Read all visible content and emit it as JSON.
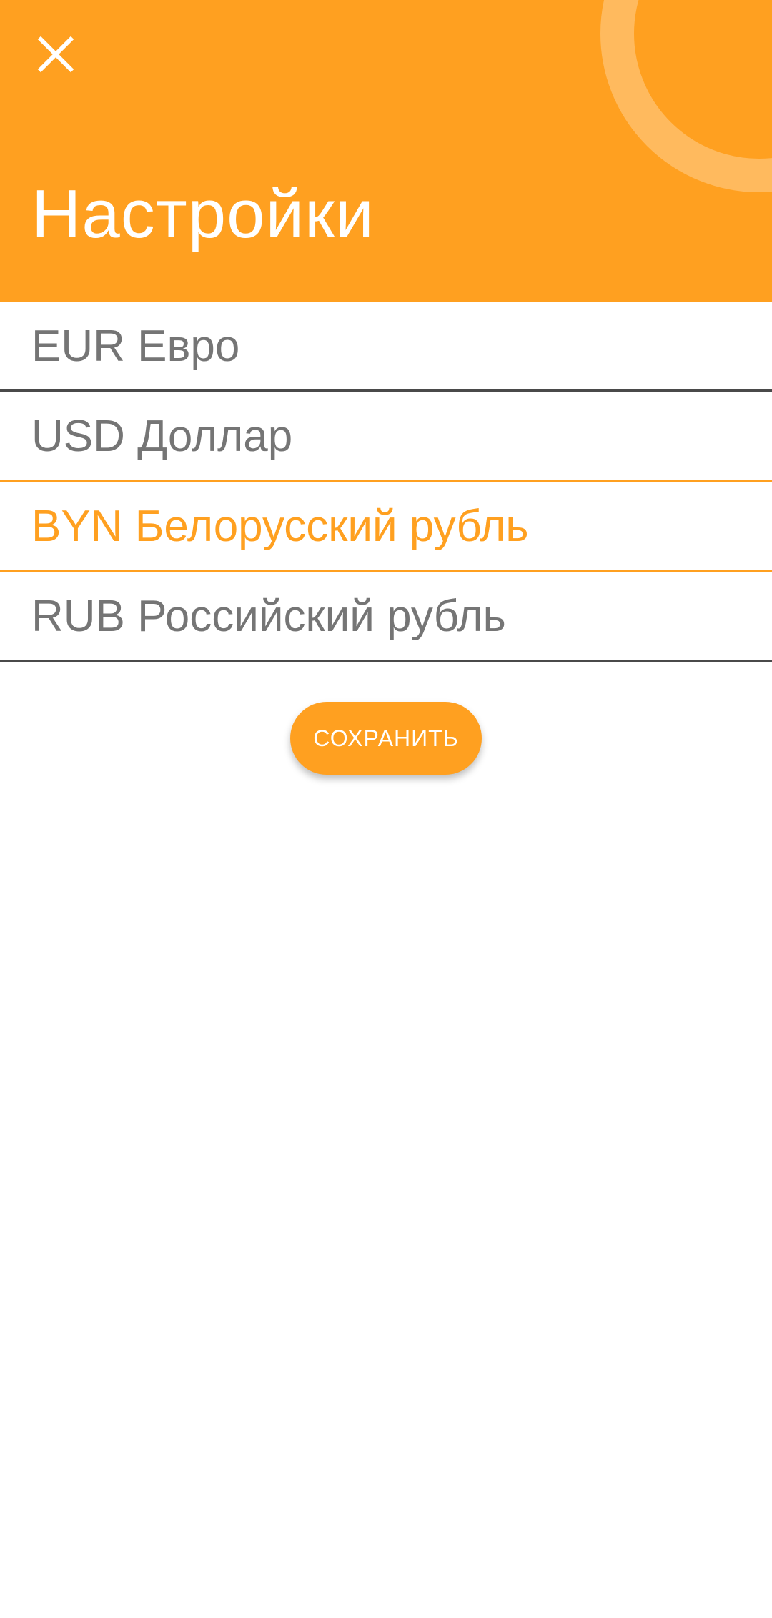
{
  "header": {
    "title": "Настройки",
    "close_icon": "close-icon",
    "color": "#FFA020"
  },
  "currencies": [
    {
      "label": "EUR Евро",
      "selected": false
    },
    {
      "label": "USD Доллар",
      "selected": false
    },
    {
      "label": "BYN Белорусский рубль",
      "selected": true
    },
    {
      "label": "RUB Российский рубль",
      "selected": false
    }
  ],
  "actions": {
    "save_label": "СОХРАНИТЬ"
  },
  "colors": {
    "accent": "#FFA020",
    "text": "#757575",
    "divider": "#4a4a4a"
  }
}
